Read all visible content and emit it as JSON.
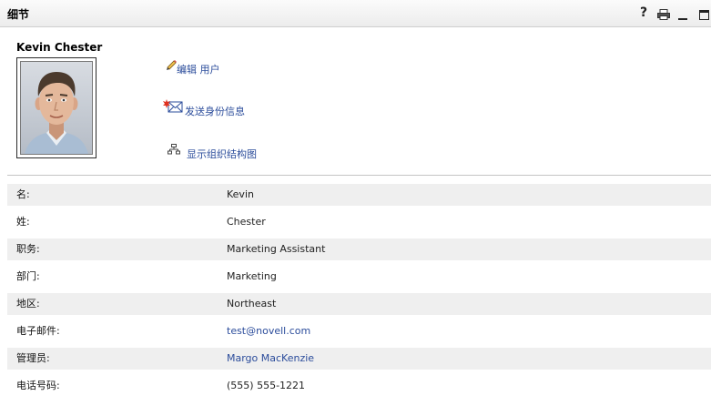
{
  "panel": {
    "title": "细节",
    "help_glyph": "?",
    "toolbar_icons": [
      "help-icon",
      "printer-icon",
      "minimize-icon",
      "maximize-icon"
    ]
  },
  "user": {
    "full_name": "Kevin Chester"
  },
  "actions": [
    {
      "icon": "pencil-icon",
      "label": "编辑 用户"
    },
    {
      "icon": "envelope-icon",
      "label": "发送身份信息"
    },
    {
      "icon": "org-chart-icon",
      "label": "显示组织结构图"
    }
  ],
  "details": [
    {
      "label": "名:",
      "value": "Kevin"
    },
    {
      "label": "姓:",
      "value": "Chester"
    },
    {
      "label": "职务:",
      "value": "Marketing Assistant"
    },
    {
      "label": "部门:",
      "value": "Marketing"
    },
    {
      "label": "地区:",
      "value": "Northeast"
    },
    {
      "label": "电子邮件:",
      "value": "test@novell.com"
    },
    {
      "label": "管理员:",
      "value": "Margo MacKenzie"
    },
    {
      "label": "电话号码:",
      "value": "(555) 555-1221"
    }
  ],
  "colors": {
    "link": "#2b4c9b",
    "row_alt": "#efefef",
    "text": "#1a1a1a"
  }
}
